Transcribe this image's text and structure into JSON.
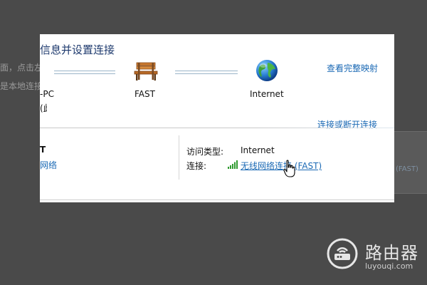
{
  "background": {
    "lines": [
      "面，点击左",
      "是本地连接"
    ],
    "right_link": "(FAST)"
  },
  "panel": {
    "title": "信息并设置连接",
    "view_full_map": "查看完整映射",
    "connect_disconnect": "连接或断开连接",
    "nodes": {
      "pc_label": "-PC",
      "pc_sub": "(此计算机)",
      "router_label": "FAST",
      "internet_label": "Internet"
    },
    "left_network": {
      "name": "T",
      "type": "网络"
    },
    "details": {
      "access_type_label": "访问类型:",
      "access_type_value": "Internet",
      "connection_label": "连接:",
      "connection_value": "无线网络连接 (FAST)"
    }
  },
  "watermark": {
    "name": "路由器",
    "domain": "luyouqi.com"
  },
  "colors": {
    "link": "#1c6ab5",
    "title": "#1e3a6e",
    "overlay": "#3a3a3a"
  },
  "icons": [
    "bench-icon",
    "globe-icon",
    "signal-bars-icon",
    "hand-cursor-icon",
    "router-logo-icon"
  ]
}
